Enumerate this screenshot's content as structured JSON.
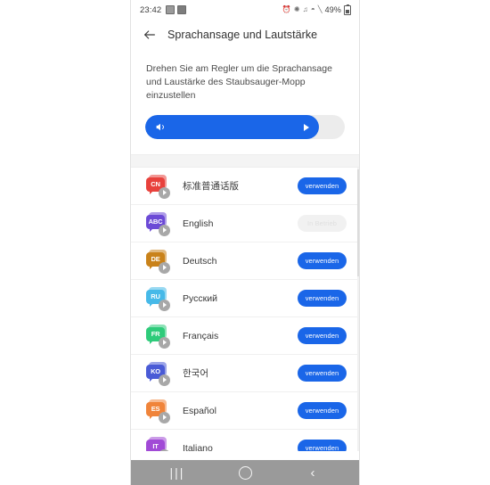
{
  "status_bar": {
    "time": "23:42",
    "left_icons": [
      "app-notification-icon",
      "calendar-notification-icon"
    ],
    "right_icons": [
      "alarm-icon",
      "bluetooth-icon",
      "vibrate-icon",
      "wifi-icon",
      "signal-icon"
    ],
    "battery_percent": "49%"
  },
  "app_bar": {
    "back_label": "←",
    "title": "Sprachansage und Lautstärke"
  },
  "top_card": {
    "instruction": "Drehen Sie am Regler um die Sprachansage und Laustärke des Staubsauger-Mopp einzustellen"
  },
  "slider": {
    "name": "volume-slider",
    "fill_percent": 87,
    "speaker_icon": "speaker-icon",
    "handle_icon": "play-triangle-icon",
    "fill_color": "#1a66e8",
    "track_color": "#ececec"
  },
  "languages": [
    {
      "code": "CN",
      "name": "标准普通话版",
      "color": "#e8413c",
      "action": "verwenden",
      "active": false
    },
    {
      "code": "ABC",
      "name": "English",
      "color": "#6c4ad6",
      "action": "In Betrieb",
      "active": true
    },
    {
      "code": "DE",
      "name": "Deutsch",
      "color": "#c9821a",
      "action": "verwenden",
      "active": false
    },
    {
      "code": "RU",
      "name": "Русский",
      "color": "#46b9e8",
      "action": "verwenden",
      "active": false
    },
    {
      "code": "FR",
      "name": "Français",
      "color": "#2ecb7a",
      "action": "verwenden",
      "active": false
    },
    {
      "code": "KO",
      "name": "한국어",
      "color": "#4a5bd6",
      "action": "verwenden",
      "active": false
    },
    {
      "code": "ES",
      "name": "Español",
      "color": "#f0843a",
      "action": "verwenden",
      "active": false
    },
    {
      "code": "IT",
      "name": "Italiano",
      "color": "#a14ad6",
      "action": "verwenden",
      "active": false
    }
  ],
  "nav_bar": {
    "recents_label": "|||",
    "home_label": "home-circle-icon",
    "back_label": "‹"
  },
  "colors": {
    "accent": "#1a66e8",
    "nav_bar_bg": "#9a9a9a",
    "divider": "#f4f4f4"
  }
}
